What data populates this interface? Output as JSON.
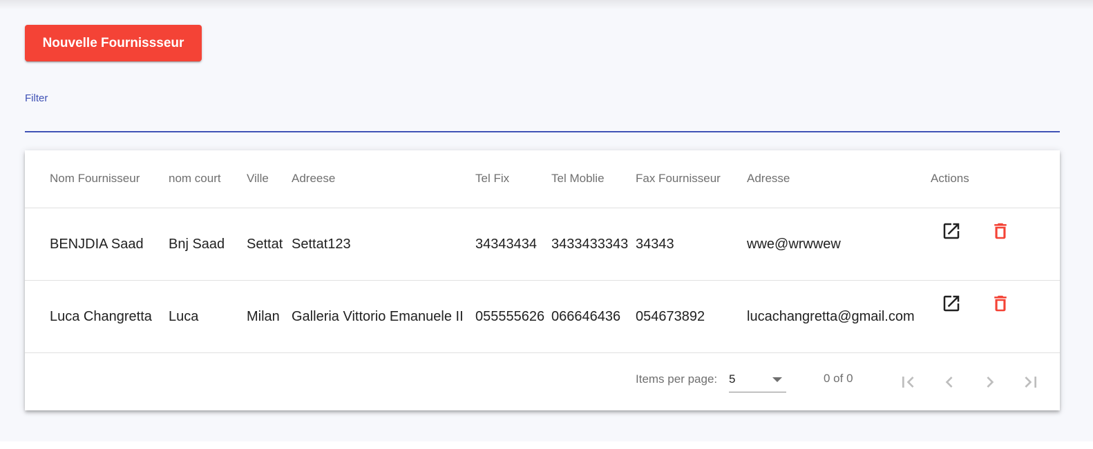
{
  "toolbar": {
    "new_button_label": "Nouvelle Fournissseur"
  },
  "filter": {
    "label": "Filter",
    "value": ""
  },
  "table": {
    "columns": [
      "Nom Fournisseur",
      "nom court",
      "Ville",
      "Adreese",
      "Tel Fix",
      "Tel Moblie",
      "Fax Fournisseur",
      "Adresse",
      "Actions"
    ],
    "rows": [
      [
        "BENJDIA Saad",
        "Bnj Saad",
        "Settat",
        "Settat123",
        "34343434",
        "3433433343",
        "34343",
        "wwe@wrwwew"
      ],
      [
        "Luca Changretta",
        "Luca",
        "Milan",
        "Galleria Vittorio Emanuele II",
        "055555626",
        "066646436",
        "054673892",
        "lucachangretta@gmail.com"
      ]
    ],
    "actions": {
      "edit_icon": "open-in-new-icon",
      "delete_icon": "trash-icon"
    }
  },
  "paginator": {
    "items_per_page_label": "Items per page:",
    "page_size": "5",
    "range_label": "0 of 0"
  },
  "colors": {
    "accent": "#f44336",
    "primary": "#3f51b5",
    "delete_icon": "#f44336"
  }
}
